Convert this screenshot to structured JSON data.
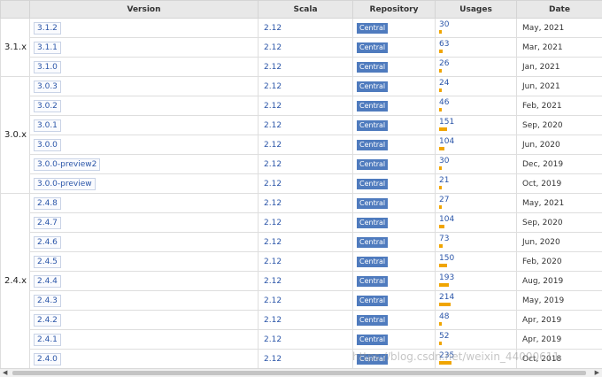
{
  "headers": {
    "group": "",
    "version": "Version",
    "scala": "Scala",
    "repository": "Repository",
    "usages": "Usages",
    "date": "Date"
  },
  "colors": {
    "badge": "#4f7bbe",
    "usage_bar": "#f0a500",
    "link": "#2a55a8"
  },
  "usage_max": 235,
  "groups": [
    {
      "label": "3.1.x",
      "rows": [
        {
          "version": "3.1.2",
          "scala": "2.12",
          "repo": "Central",
          "usages": 30,
          "date": "May, 2021"
        },
        {
          "version": "3.1.1",
          "scala": "2.12",
          "repo": "Central",
          "usages": 63,
          "date": "Mar, 2021"
        },
        {
          "version": "3.1.0",
          "scala": "2.12",
          "repo": "Central",
          "usages": 26,
          "date": "Jan, 2021"
        }
      ]
    },
    {
      "label": "3.0.x",
      "rows": [
        {
          "version": "3.0.3",
          "scala": "2.12",
          "repo": "Central",
          "usages": 24,
          "date": "Jun, 2021"
        },
        {
          "version": "3.0.2",
          "scala": "2.12",
          "repo": "Central",
          "usages": 46,
          "date": "Feb, 2021"
        },
        {
          "version": "3.0.1",
          "scala": "2.12",
          "repo": "Central",
          "usages": 151,
          "date": "Sep, 2020"
        },
        {
          "version": "3.0.0",
          "scala": "2.12",
          "repo": "Central",
          "usages": 104,
          "date": "Jun, 2020"
        },
        {
          "version": "3.0.0-preview2",
          "scala": "2.12",
          "repo": "Central",
          "usages": 30,
          "date": "Dec, 2019"
        },
        {
          "version": "3.0.0-preview",
          "scala": "2.12",
          "repo": "Central",
          "usages": 21,
          "date": "Oct, 2019"
        }
      ]
    },
    {
      "label": "2.4.x",
      "rows": [
        {
          "version": "2.4.8",
          "scala": "2.12",
          "repo": "Central",
          "usages": 27,
          "date": "May, 2021"
        },
        {
          "version": "2.4.7",
          "scala": "2.12",
          "repo": "Central",
          "usages": 104,
          "date": "Sep, 2020"
        },
        {
          "version": "2.4.6",
          "scala": "2.12",
          "repo": "Central",
          "usages": 73,
          "date": "Jun, 2020"
        },
        {
          "version": "2.4.5",
          "scala": "2.12",
          "repo": "Central",
          "usages": 150,
          "date": "Feb, 2020"
        },
        {
          "version": "2.4.4",
          "scala": "2.12",
          "repo": "Central",
          "usages": 193,
          "date": "Aug, 2019"
        },
        {
          "version": "2.4.3",
          "scala": "2.12",
          "repo": "Central",
          "usages": 214,
          "date": "May, 2019"
        },
        {
          "version": "2.4.2",
          "scala": "2.12",
          "repo": "Central",
          "usages": 48,
          "date": "Apr, 2019"
        },
        {
          "version": "2.4.1",
          "scala": "2.12",
          "repo": "Central",
          "usages": 52,
          "date": "Apr, 2019"
        },
        {
          "version": "2.4.0",
          "scala": "2.12",
          "repo": "Central",
          "usages": 235,
          "date": "Oct, 2018"
        }
      ]
    }
  ],
  "watermark": "https://blog.csdn.net/weixin_44000611",
  "scrollbar": {
    "left_icon": "arrow-left-icon",
    "right_icon": "arrow-right-icon"
  }
}
